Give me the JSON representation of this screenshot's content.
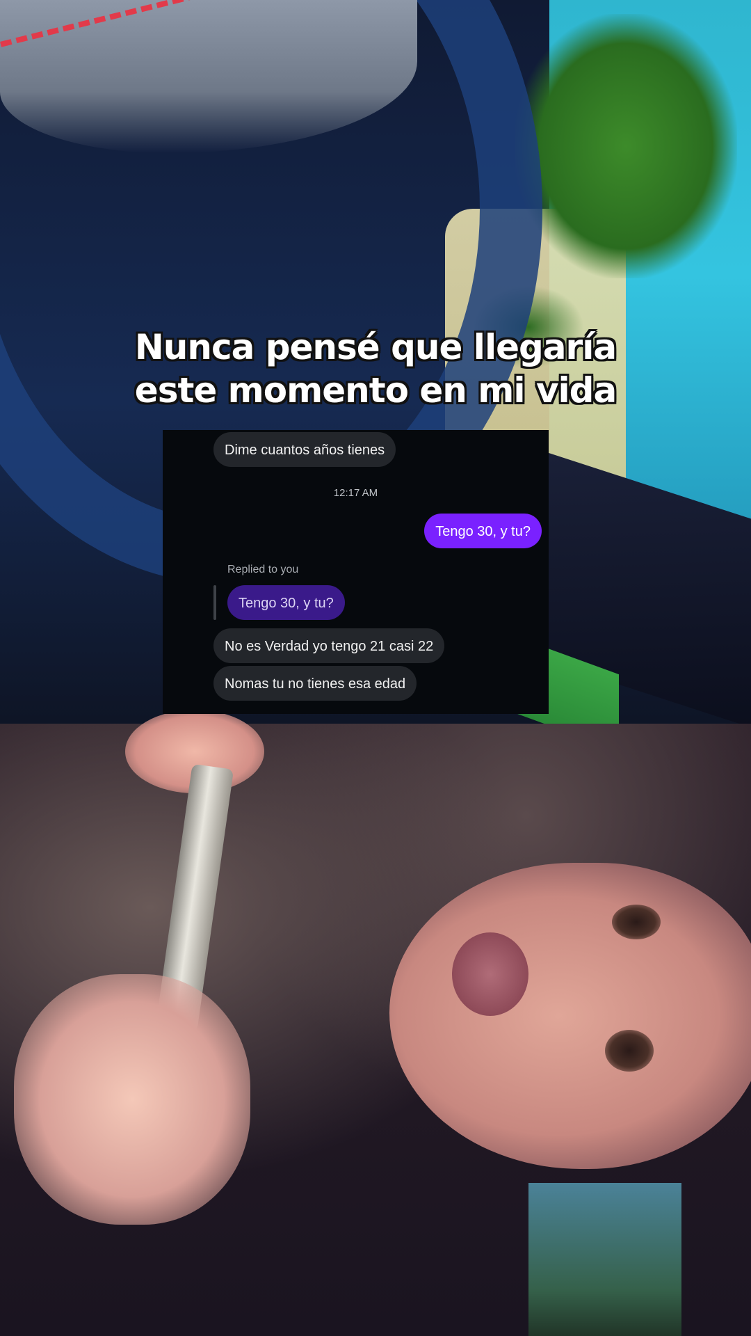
{
  "caption": {
    "line1": "Nunca pensé que llegaría",
    "line2": "este momento en mi vida"
  },
  "chat": {
    "messages": [
      {
        "direction": "received",
        "text": "Dime cuantos años tienes"
      },
      {
        "direction": "timestamp",
        "text": "12:17 AM"
      },
      {
        "direction": "sent",
        "text": "Tengo 30, y tu?"
      },
      {
        "direction": "reply_label",
        "text": "Replied to you"
      },
      {
        "direction": "quoted",
        "text": "Tengo 30, y tu?"
      },
      {
        "direction": "received",
        "text": "No es Verdad yo tengo 21 casi 22"
      },
      {
        "direction": "received",
        "text": "Nomas tu no tienes esa edad"
      }
    ],
    "colors": {
      "panel_background": "#06090d",
      "received_bubble": "#23262b",
      "sent_bubble": "#7a21ff",
      "quoted_bubble": "#3a1a8a"
    }
  }
}
